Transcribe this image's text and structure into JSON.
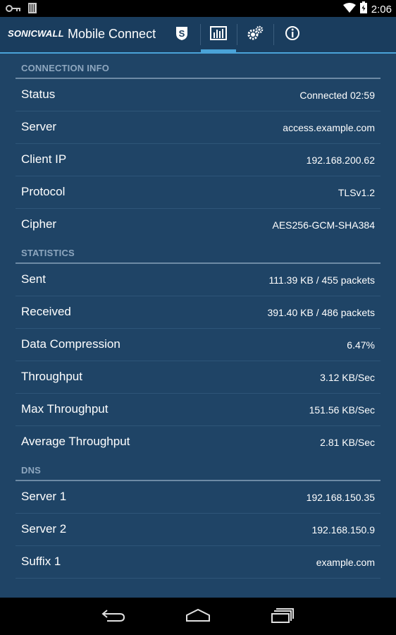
{
  "status_bar": {
    "time": "2:06",
    "icons": [
      "key-icon",
      "sim-icon",
      "wifi-icon",
      "battery-icon"
    ]
  },
  "action_bar": {
    "logo": "SONICWALL",
    "title": "Mobile Connect",
    "tabs": [
      {
        "name": "connection",
        "icon": "shield-s-icon",
        "active": false
      },
      {
        "name": "statistics",
        "icon": "bar-chart-icon",
        "active": true
      },
      {
        "name": "settings",
        "icon": "gears-icon",
        "active": false
      },
      {
        "name": "about",
        "icon": "info-icon",
        "active": false
      }
    ],
    "accent_color": "#4aa3d8"
  },
  "sections": [
    {
      "header": "CONNECTION INFO",
      "rows": [
        {
          "label": "Status",
          "value": "Connected 02:59"
        },
        {
          "label": "Server",
          "value": "access.example.com"
        },
        {
          "label": "Client IP",
          "value": "192.168.200.62"
        },
        {
          "label": "Protocol",
          "value": "TLSv1.2"
        },
        {
          "label": "Cipher",
          "value": "AES256-GCM-SHA384"
        }
      ]
    },
    {
      "header": "STATISTICS",
      "rows": [
        {
          "label": "Sent",
          "value": "111.39 KB / 455  packets"
        },
        {
          "label": "Received",
          "value": "391.40 KB / 486  packets"
        },
        {
          "label": "Data Compression",
          "value": "6.47%"
        },
        {
          "label": "Throughput",
          "value": "3.12 KB/Sec"
        },
        {
          "label": "Max Throughput",
          "value": "151.56 KB/Sec"
        },
        {
          "label": "Average Throughput",
          "value": "2.81 KB/Sec"
        }
      ]
    },
    {
      "header": "DNS",
      "rows": [
        {
          "label": "Server 1",
          "value": "192.168.150.35"
        },
        {
          "label": "Server 2",
          "value": "192.168.150.9"
        },
        {
          "label": "Suffix 1",
          "value": "example.com"
        }
      ]
    }
  ],
  "nav_bar": {
    "buttons": [
      "back-icon",
      "home-icon",
      "recents-icon"
    ]
  }
}
